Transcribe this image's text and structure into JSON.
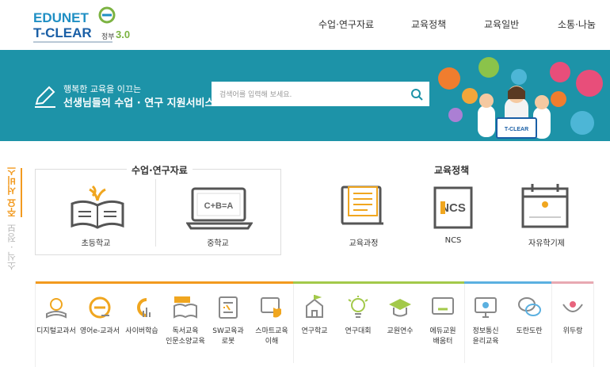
{
  "brand": {
    "line1": "EDUNET",
    "line2": "T-CLEAR",
    "gov": "정부",
    "ver": "3.0"
  },
  "nav": [
    "수업·연구자료",
    "교육정책",
    "교육일반",
    "소통·나눔"
  ],
  "banner": {
    "line1": "행복한 교육을 이끄는",
    "line2": "선생님들의 수업 · 연구 지원서비스",
    "search_placeholder": "검색어를 입력해 보세요.",
    "monitor_label": "T-CLEAR"
  },
  "sidetab": {
    "active": "주요 서비스",
    "inactive": "소식 · 정보"
  },
  "sections": {
    "research": {
      "title": "수업·연구자료",
      "items": [
        "초등학교",
        "중학교"
      ],
      "board_text": "C+B=A"
    },
    "policy": {
      "title": "교육정책",
      "items": [
        "교육과정",
        "NCS",
        "자유학기제"
      ],
      "ncs_text": "NCS"
    }
  },
  "bottom_items": [
    "디지털교과서",
    "영어e-교과서",
    "사이버학습",
    "독서교육\n인문소양교육",
    "SW교육과\n로봇",
    "스마트교육\n이해",
    "연구학교",
    "연구대회",
    "교원연수",
    "에듀교원\n배움터",
    "정보통신\n윤리교육",
    "도란도란",
    "위두랑"
  ],
  "colors": {
    "banner": "#1d93a8",
    "accent": "#f29a1f",
    "green": "#a3c94a",
    "blue": "#5bb0e0",
    "pink": "#e8647d"
  }
}
